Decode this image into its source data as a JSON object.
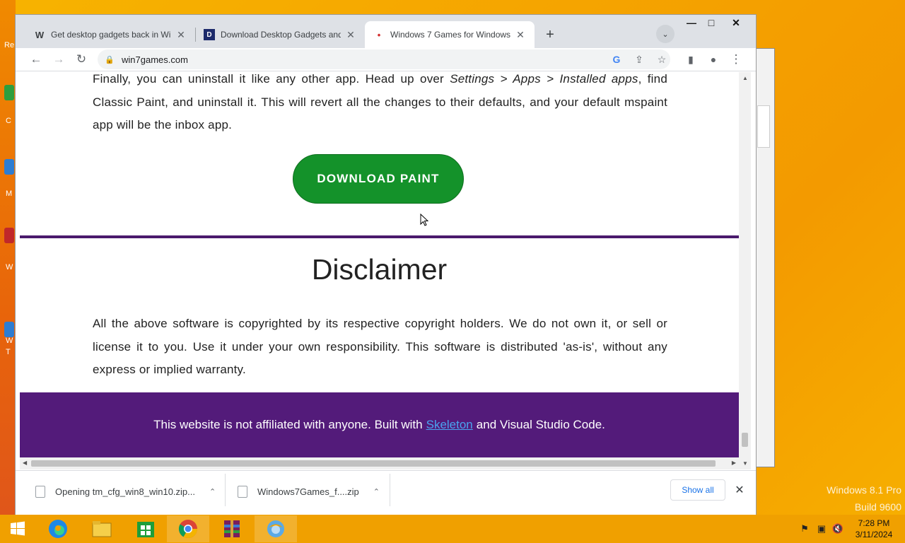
{
  "desktop": {
    "watermark_line1": "Windows 8.1 Pro",
    "watermark_line2": "Build 9600",
    "icon_labels": [
      "Re",
      "C",
      "M",
      "W",
      "W",
      "T"
    ]
  },
  "window_controls": {
    "minimize": "—",
    "maximize": "□",
    "close": "✕"
  },
  "tabs": [
    {
      "favicon": "W",
      "title": "Get desktop gadgets back in Wi",
      "close": "✕"
    },
    {
      "favicon": "D",
      "title": "Download Desktop Gadgets and",
      "close": "✕"
    },
    {
      "favicon": "•",
      "title": "Windows 7 Games for Windows",
      "close": "✕",
      "active": true
    }
  ],
  "new_tab": "+",
  "tab_search": "⌄",
  "toolbar": {
    "back": "←",
    "forward": "→",
    "reload": "↻",
    "lock": "🔒",
    "url": "win7games.com",
    "google": "G",
    "share": "⇪",
    "bookmark": "☆",
    "sidepanel": "▮",
    "profile": "●",
    "menu": "⋮"
  },
  "content": {
    "para1_a": "Finally, you can uninstall it like any other app. Head up over ",
    "para1_em": "Settings > Apps > Installed apps",
    "para1_b": ", find Classic Paint, and uninstall it. This will revert all the changes to their defaults, and your default mspaint app will be the inbox app.",
    "download_button": "DOWNLOAD PAINT",
    "disclaimer_heading": "Disclaimer",
    "disclaimer_text": "All the above software is copyrighted by its respective copyright holders. We do not own it, or sell or license it to you. Use it under your own responsibility. This software is distributed 'as-is', without any express or implied warranty.",
    "footer_prefix": "This website is not affiliated with anyone. Built with",
    "footer_link": "Skeleton",
    "footer_suffix": "and Visual Studio Code."
  },
  "downloads": {
    "items": [
      {
        "name": "Opening tm_cfg_win8_win10.zip...",
        "chevron": "⌃"
      },
      {
        "name": "Windows7Games_f....zip",
        "chevron": "⌃"
      }
    ],
    "show_all": "Show all",
    "close": "✕"
  },
  "taskbar": {
    "apps": [
      "start",
      "edge",
      "file-explorer",
      "store",
      "chrome",
      "winrar",
      "browser"
    ],
    "clock_time": "7:28 PM",
    "clock_date": "3/11/2024"
  },
  "colors": {
    "download_green": "#14922a",
    "footer_purple": "#531b7a",
    "divider_purple": "#4a1a6c",
    "link_blue": "#4aa3f0"
  }
}
